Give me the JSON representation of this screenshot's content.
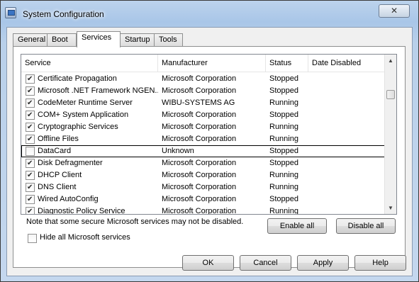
{
  "window": {
    "title": "System Configuration",
    "close_symbol": "✕"
  },
  "tabs": [
    "General",
    "Boot",
    "Services",
    "Startup",
    "Tools"
  ],
  "active_tab": "Services",
  "columns": {
    "service": "Service",
    "manufacturer": "Manufacturer",
    "status": "Status",
    "date_disabled": "Date Disabled"
  },
  "services": [
    {
      "checked": true,
      "name": "Certificate Propagation",
      "manufacturer": "Microsoft Corporation",
      "status": "Stopped"
    },
    {
      "checked": true,
      "name": "Microsoft .NET Framework NGEN...",
      "manufacturer": "Microsoft Corporation",
      "status": "Stopped"
    },
    {
      "checked": true,
      "name": "CodeMeter Runtime Server",
      "manufacturer": "WIBU-SYSTEMS AG",
      "status": "Running"
    },
    {
      "checked": true,
      "name": "COM+ System Application",
      "manufacturer": "Microsoft Corporation",
      "status": "Stopped"
    },
    {
      "checked": true,
      "name": "Cryptographic Services",
      "manufacturer": "Microsoft Corporation",
      "status": "Running"
    },
    {
      "checked": true,
      "name": "Offline Files",
      "manufacturer": "Microsoft Corporation",
      "status": "Running"
    },
    {
      "checked": false,
      "name": "DataCard",
      "manufacturer": "Unknown",
      "status": "Stopped",
      "focused": true
    },
    {
      "checked": true,
      "name": "Disk Defragmenter",
      "manufacturer": "Microsoft Corporation",
      "status": "Stopped"
    },
    {
      "checked": true,
      "name": "DHCP Client",
      "manufacturer": "Microsoft Corporation",
      "status": "Running"
    },
    {
      "checked": true,
      "name": "DNS Client",
      "manufacturer": "Microsoft Corporation",
      "status": "Running"
    },
    {
      "checked": true,
      "name": "Wired AutoConfig",
      "manufacturer": "Microsoft Corporation",
      "status": "Stopped"
    },
    {
      "checked": true,
      "name": "Diagnostic Policy Service",
      "manufacturer": "Microsoft Corporation",
      "status": "Running"
    }
  ],
  "note": "Note that some secure Microsoft services may not be disabled.",
  "buttons": {
    "enable_all": "Enable all",
    "disable_all": "Disable all",
    "ok": "OK",
    "cancel": "Cancel",
    "apply": "Apply",
    "help": "Help"
  },
  "hide_ms": {
    "label": "Hide all Microsoft services",
    "checked": false
  },
  "scroll": {
    "up_icon": "▲",
    "down_icon": "▼"
  }
}
